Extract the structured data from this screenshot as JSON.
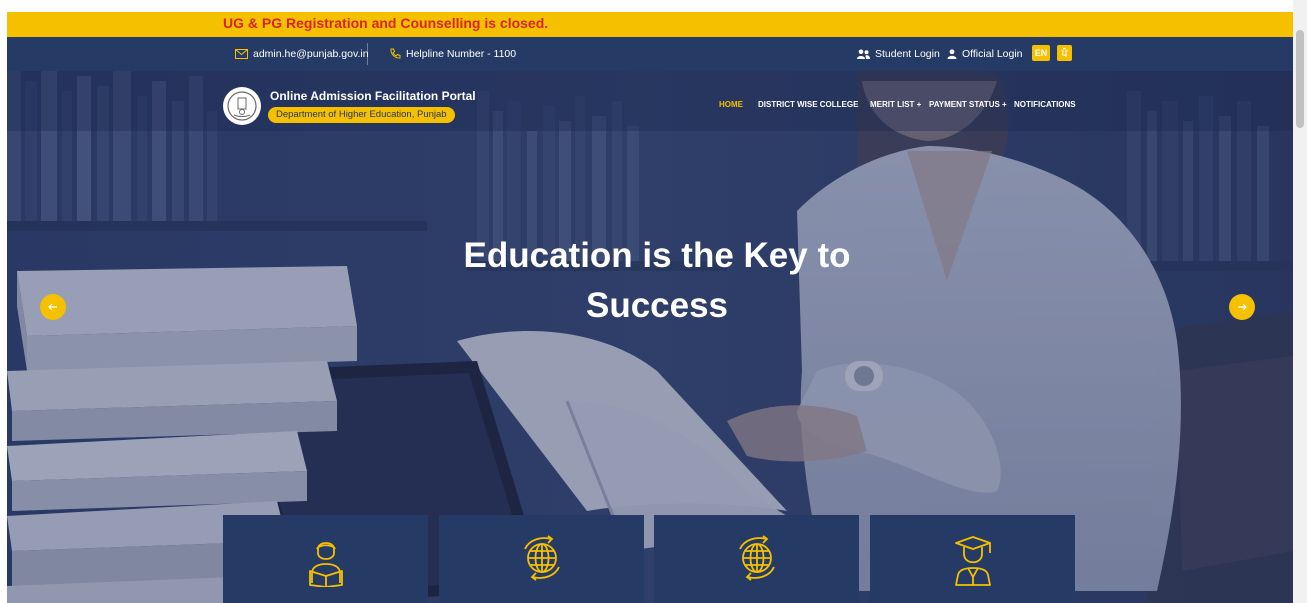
{
  "announcement": "UG & PG Registration and Counselling is closed.",
  "topbar": {
    "email": "admin.he@punjab.gov.in",
    "email_icon": "mail-icon",
    "helpline": "Helpline Number - 1100",
    "helpline_icon": "phone-icon",
    "student_login": "Student Login",
    "official_login": "Official Login",
    "lang_en": "EN",
    "lang_pa": "ਪੰ"
  },
  "header": {
    "portal_name": "Online Admission Facilitation Portal",
    "department": "Department of Higher Education, Punjab"
  },
  "nav": {
    "items": [
      "HOME",
      "DISTRICT WISE COLLEGE",
      "MERIT LIST +",
      "PAYMENT STATUS +",
      "NOTIFICATIONS"
    ],
    "active": "HOME"
  },
  "hero": {
    "title_line1": "Education is the Key to",
    "title_line2": "Success"
  },
  "cards": [
    {
      "icon": "student-reading-icon"
    },
    {
      "icon": "globe-icon"
    },
    {
      "icon": "globe-icon"
    },
    {
      "icon": "graduate-icon"
    }
  ],
  "colors": {
    "accent": "#f5c000",
    "navy": "#263a66",
    "alert_text": "#d7261e"
  }
}
